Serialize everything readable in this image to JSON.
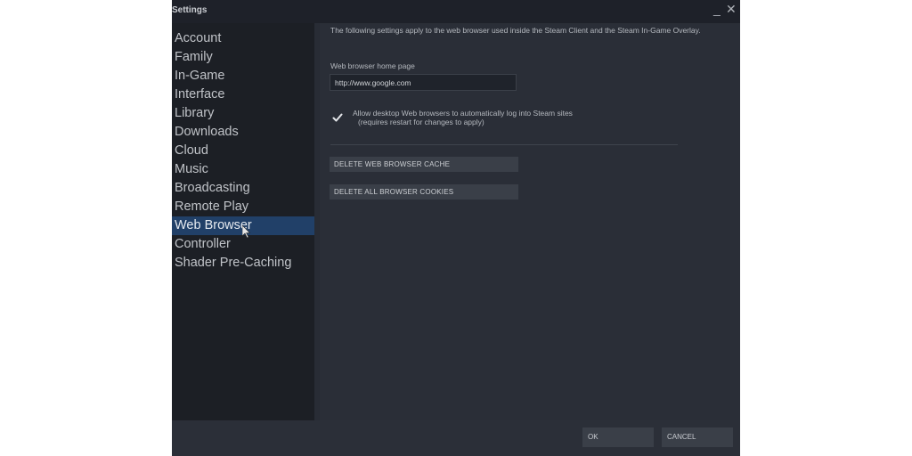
{
  "window": {
    "title": "Settings",
    "minimize_icon": "minimize-icon",
    "close_icon": "close-icon",
    "minimize_glyph": "_",
    "close_glyph": "✕"
  },
  "sidebar": {
    "items": [
      {
        "label": "Account"
      },
      {
        "label": "Family"
      },
      {
        "label": "In-Game"
      },
      {
        "label": "Interface"
      },
      {
        "label": "Library"
      },
      {
        "label": "Downloads"
      },
      {
        "label": "Cloud"
      },
      {
        "label": "Music"
      },
      {
        "label": "Broadcasting"
      },
      {
        "label": "Remote Play"
      },
      {
        "label": "Web Browser",
        "active": true
      },
      {
        "label": "Controller"
      },
      {
        "label": "Shader Pre-Caching"
      }
    ]
  },
  "content": {
    "description": "The following settings apply to the web browser used inside the Steam Client and the Steam In-Game Overlay.",
    "home_page_label": "Web browser home page",
    "home_page_value": "http://www.google.com",
    "auto_login_checkbox": {
      "checked": true,
      "label": "Allow desktop Web browsers to automatically log into Steam sites",
      "sublabel": "(requires restart for changes to apply)"
    },
    "delete_cache_button": "DELETE WEB BROWSER CACHE",
    "delete_cookies_button": "DELETE ALL BROWSER COOKIES"
  },
  "footer": {
    "ok_button": "OK",
    "cancel_button": "CANCEL"
  },
  "colors": {
    "active_item": "#214068",
    "sidebar_bg": "#1c1f25",
    "content_bg": "#2a2e37",
    "button_bg": "#3a3f48"
  }
}
